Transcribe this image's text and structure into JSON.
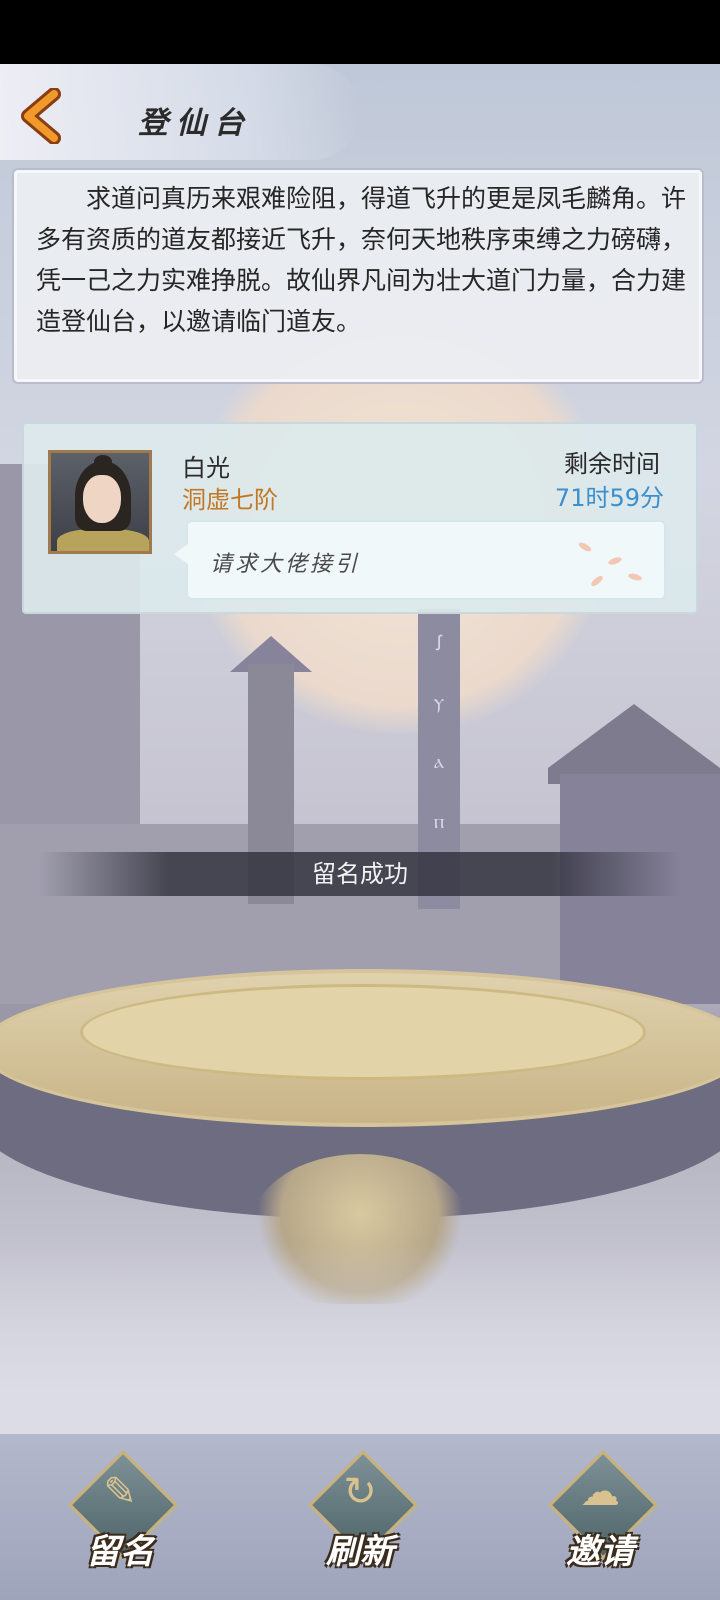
{
  "header": {
    "title": "登仙台"
  },
  "intro": {
    "text": "求道问真历来艰难险阻，得道飞升的更是凤毛麟角。许多有资质的道友都接近飞升，奈何天地秩序束缚之力磅礴，凭一己之力实难挣脱。故仙界凡间为壮大道门力量，合力建造登仙台，以邀请临门道友。"
  },
  "player_card": {
    "name": "白光",
    "rank": "洞虚七阶",
    "time_label": "剩余时间",
    "time_remaining": "71时59分",
    "message": "请求大佬接引"
  },
  "pillar_glyphs": [
    "ꭍ",
    "ⲩ",
    "ⲁ",
    "ⲡ"
  ],
  "toast": {
    "text": "留名成功"
  },
  "bottom_buttons": [
    {
      "label": "留名",
      "icon": "brush-icon"
    },
    {
      "label": "刷新",
      "icon": "swirl-icon"
    },
    {
      "label": "邀请",
      "icon": "cloud-icon"
    }
  ],
  "colors": {
    "rank": "#c27824",
    "time_value": "#3a8fce",
    "back_arrow": "#e98b21"
  }
}
